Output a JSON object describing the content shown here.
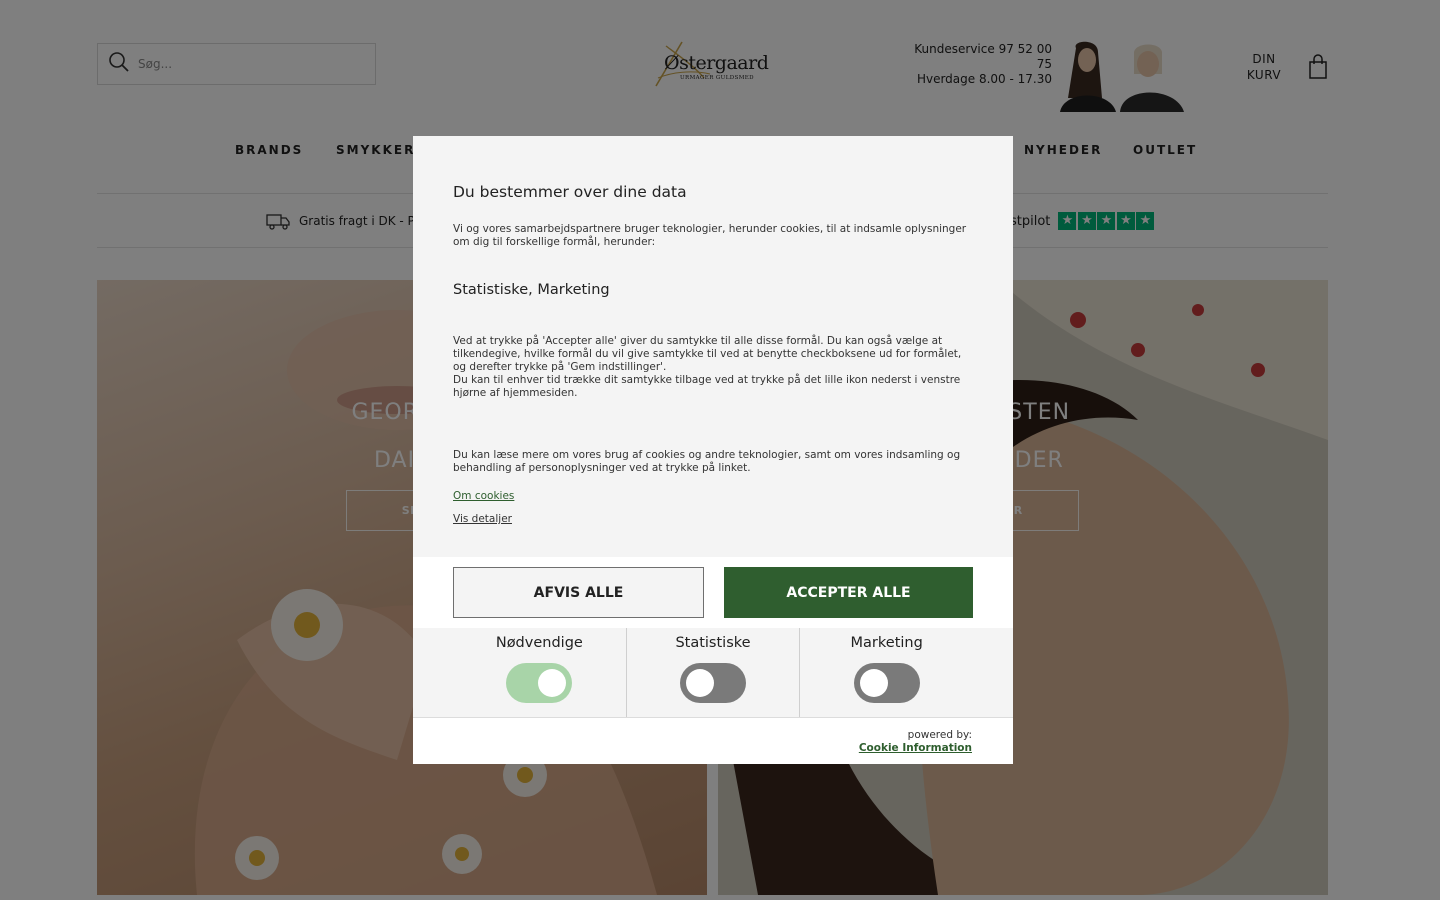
{
  "header": {
    "search_placeholder": "Søg...",
    "logo_text": "Østergaard",
    "logo_subtitle": "URMAGER GULDSMED",
    "service_line1": "Kundeservice 97 52 00",
    "service_line2": "75",
    "service_line3": "Hverdage 8.00 - 17.30",
    "cart_line1": "DIN",
    "cart_line2": "KURV"
  },
  "nav": {
    "brands": "BRANDS",
    "smykker": "SMYKKER",
    "nyheder": "NYHEDER",
    "outlet": "OUTLET"
  },
  "usp": {
    "shipping": "Gratis fragt i DK - På",
    "trustpilot": "stpilot",
    "trustpilot_stars": 5
  },
  "banners": {
    "left_title1": "GEORG J",
    "left_title2": "DAIS",
    "left_button": "SHOP H",
    "right_title1": "NESTEN",
    "right_title2": "HEDER",
    "right_button": "OP HER"
  },
  "cookie_dialog": {
    "title": "Du bestemmer over dine data",
    "intro": "Vi og vores samarbejdspartnere bruger teknologier, herunder cookies, til at indsamle oplysninger om dig til forskellige formål, herunder:",
    "purposes": "Statistiske, Marketing",
    "consent_text": "Ved at trykke på 'Accepter alle' giver du samtykke til alle disse formål. Du kan også vælge at tilkendegive, hvilke formål du vil give samtykke til ved at benytte checkboksene ud for formålet, og derefter trykke på 'Gem indstillinger'.",
    "withdraw_text": "Du kan til enhver tid trække dit samtykke tilbage ved at trykke på det lille ikon nederst i venstre hjørne af hjemmesiden.",
    "more_text": "Du kan læse mere om vores brug af cookies og andre teknologier, samt om vores indsamling og behandling af personoplysninger ved at trykke på linket.",
    "link_cookies": "Om cookies",
    "link_details": "Vis detaljer",
    "reject_button": "AFVIS ALLE",
    "accept_button": "ACCEPTER ALLE",
    "toggles": [
      {
        "label": "Nødvendige",
        "state": "on"
      },
      {
        "label": "Statistiske",
        "state": "off"
      },
      {
        "label": "Marketing",
        "state": "off"
      }
    ],
    "powered_by": "powered by:",
    "provider": "Cookie Information"
  },
  "colors": {
    "accent_green": "#2f5e2f",
    "toggle_on": "#a8d4a8",
    "toggle_off": "#7a7a7a",
    "trustpilot_green": "#00b67a"
  }
}
